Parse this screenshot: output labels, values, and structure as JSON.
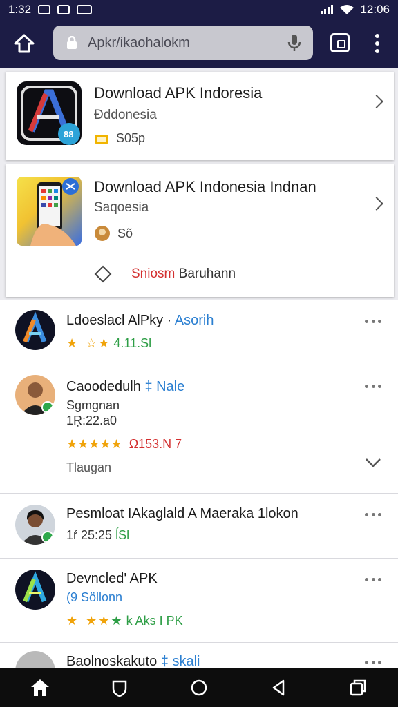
{
  "status_bar": {
    "time": "1:32",
    "right_clock": "12:06"
  },
  "browser": {
    "url_text": "Apkr/ikaohalokm",
    "icons": [
      "home-icon",
      "lock-icon",
      "mic-icon",
      "tabs-icon",
      "overflow-menu-icon"
    ]
  },
  "cards": [
    {
      "title": "Download APK Indoresia",
      "subtitle": "Ðddonesia",
      "meta": "S05p",
      "icon": "apk-app-icon"
    },
    {
      "title": "Download APK Indonesia Indnan",
      "subtitle": "Saqoesia",
      "meta": "Sõ",
      "footer_red": "Sniosm",
      "footer_text": "Baruhann",
      "icon": "phone-app-icon"
    }
  ],
  "rows": [
    {
      "title": "Ldoeslacl AlPky ·",
      "accent": "Asorih",
      "rating": "4.11.Sl",
      "avatar": "apk-logo"
    },
    {
      "title": "Caoodedulh",
      "accent": "‡ Nale",
      "sub1": "Sgmgnan",
      "sub2": "1Ŗ:22.a0",
      "rating": "Ω153.N 7",
      "footer": "Tlaugan",
      "avatar": "person"
    },
    {
      "title": "Pesmloat IAkaglald A Maeraka 1lokon",
      "accent": "",
      "sub1": "1ŕ 25:25",
      "rating_suffix": "ĺSl",
      "avatar": "person"
    },
    {
      "title": "Devncled' APK",
      "accent": "",
      "sub1": "(9 Söllonn",
      "rating": "k Aks I PK",
      "avatar": "apk-logo-green"
    },
    {
      "title": "Baolnoskakuto",
      "accent": "‡ skali",
      "avatar": "person"
    }
  ],
  "colors": {
    "bar": "#1c1c45",
    "accent_blue": "#2b7fd1",
    "star": "#f0a30a",
    "red": "#d32f2f",
    "green": "#2e9e46"
  }
}
